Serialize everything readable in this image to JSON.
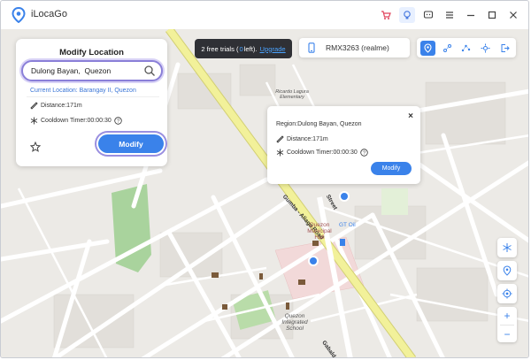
{
  "app": {
    "title": "iLocaGo",
    "titlebar_icons": [
      "cart-icon",
      "bulb-icon",
      "chat-icon",
      "menu-icon",
      "minimize-icon",
      "maximize-icon",
      "close-icon"
    ]
  },
  "modify_panel": {
    "title": "Modify Location",
    "search_value": "Dulong Bayan,  Quezon",
    "current_location": "Current Location: Barangay II, Quezon",
    "distance": "Distance:171m",
    "cooldown": "Cooldown Timer:00:00:30",
    "modify_label": "Modify"
  },
  "trial": {
    "prefix": "2 free trials (",
    "count": "0",
    "suffix": "left).",
    "upgrade_label": "Upgrade"
  },
  "device": {
    "name": "RMX3263 (realme)"
  },
  "mode_buttons": [
    "teleport-mode-icon",
    "two-spot-mode-icon",
    "multi-spot-mode-icon",
    "joystick-mode-icon",
    "export-icon"
  ],
  "popup": {
    "close_label": "×",
    "region": "Region:Dulong Bayan, Quezon",
    "distance": "Distance:171m",
    "cooldown": "Cooldown Timer:00:00:30",
    "modify_label": "Modify"
  },
  "map": {
    "road_labels": [
      "Gumba - Aliaga Road",
      "Street",
      "Gabaldon"
    ],
    "place_labels": [
      "Quezon Municipal Hall",
      "GT Oil",
      "Quezon Integrated School",
      "Ricardo Lagura Elementary"
    ]
  },
  "map_controls": {
    "zoom_in": "+",
    "zoom_out": "−"
  },
  "colors": {
    "accent": "#3a82ea",
    "highlight_ring": "#8a7fd8",
    "main_road": "#f2f19a",
    "map_bg": "#eceae6"
  }
}
